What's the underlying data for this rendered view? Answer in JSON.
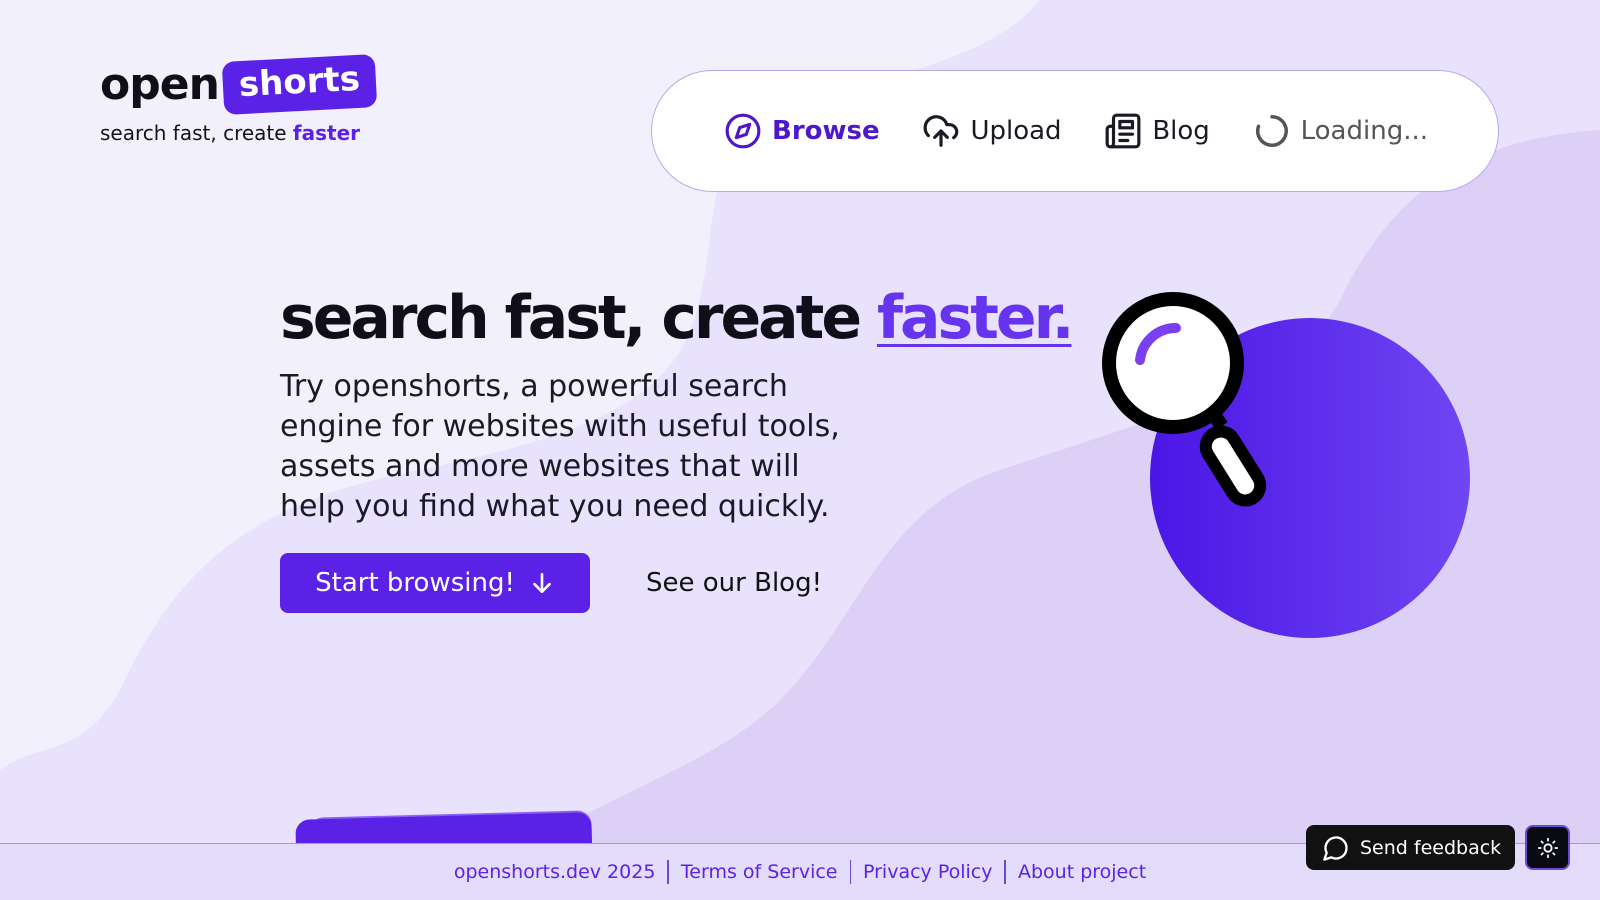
{
  "logo": {
    "open": "open",
    "shorts": "shorts"
  },
  "tagline": {
    "text": "search fast, create ",
    "accent": "faster"
  },
  "nav": {
    "items": [
      {
        "label": "Browse",
        "icon": "compass-icon",
        "active": true
      },
      {
        "label": "Upload",
        "icon": "cloud-upload-icon",
        "active": false
      },
      {
        "label": "Blog",
        "icon": "newspaper-icon",
        "active": false
      },
      {
        "label": "Loading...",
        "icon": "spinner-icon",
        "active": false
      }
    ]
  },
  "hero": {
    "title": "search fast, create ",
    "title_accent": "faster.",
    "description": "Try openshorts, a powerful search engine for websites with useful tools, assets and more websites that will help you find what you need quickly.",
    "primary_button": "Start browsing!",
    "secondary_link": "See our Blog!"
  },
  "footer": {
    "links": [
      "openshorts.dev 2025",
      "Terms of Service",
      "Privacy Policy",
      "About project"
    ]
  },
  "feedback": {
    "label": "Send feedback"
  },
  "colors": {
    "accent": "#5b21e6",
    "background": "#f3f0fd",
    "footer": "#e4dcfb"
  }
}
